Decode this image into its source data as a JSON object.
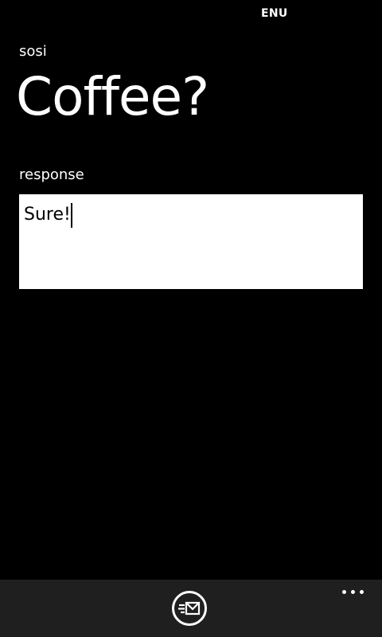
{
  "status_bar": {
    "language": "ENU"
  },
  "app": {
    "name": "sosi"
  },
  "page": {
    "title": "Coffee?"
  },
  "response": {
    "label": "response",
    "value": "Sure!"
  },
  "app_bar": {
    "send_icon": "send-message-icon",
    "more_icon": "ellipsis-icon",
    "background": "#1f1f1f"
  },
  "colors": {
    "background": "#000000",
    "foreground": "#ffffff",
    "input_background": "#ffffff",
    "input_text": "#000000"
  }
}
